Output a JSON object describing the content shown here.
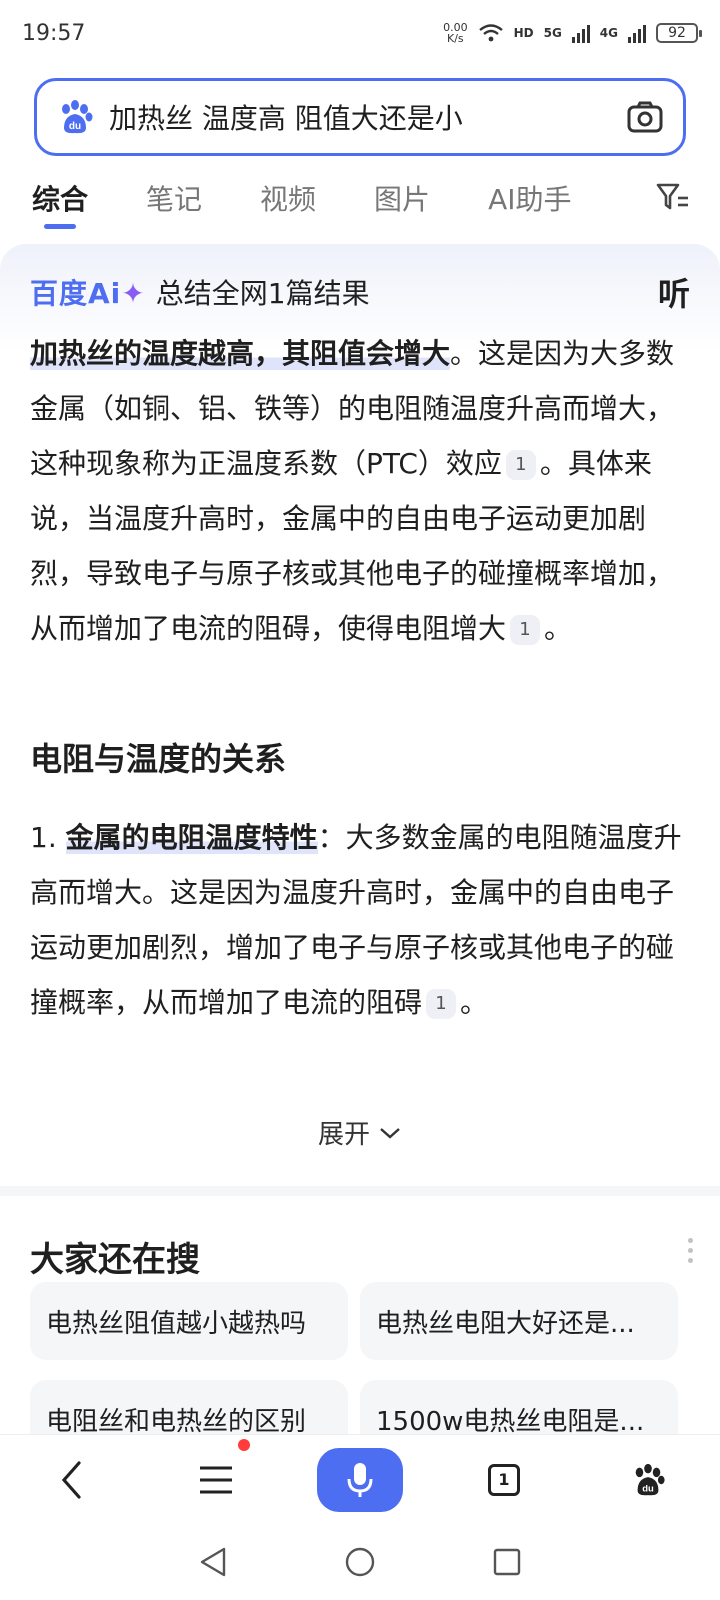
{
  "status_bar": {
    "time": "19:57",
    "net_speed_value": "0.00",
    "net_speed_unit": "K/s",
    "hd_label": "HD",
    "signal1_label": "5G",
    "signal2_label": "4G",
    "battery": "92"
  },
  "search": {
    "query": "加热丝 温度高 阻值大还是小"
  },
  "tabs": [
    {
      "label": "综合",
      "active": true
    },
    {
      "label": "笔记",
      "active": false
    },
    {
      "label": "视频",
      "active": false
    },
    {
      "label": "图片",
      "active": false
    },
    {
      "label": "AI助手",
      "active": false
    }
  ],
  "ai_card": {
    "logo_text": "百度Ai",
    "logo_sparkle": "✦",
    "summary": "总结全网1篇结果",
    "listen_label": "听",
    "para_bold": "加热丝的温度越高，其阻值会增大",
    "para_1": "。这是因为大多数金属（如铜、铝、铁等）的电阻随温度升高而增大，这种现象称为正温度系数（PTC）效应",
    "para_2": "。具体来说，当温度升高时，金属中的自由电子运动更加剧烈，导致电子与原子核或其他电子的碰撞概率增加，从而增加了电流的阻碍，使得电阻增大",
    "para_3": "。",
    "ref_1": "1",
    "section_title": "电阻与温度的关系",
    "list_num": "1.",
    "list_bold": "金属的电阻温度特性",
    "list_text": "：大多数金属的电阻随温度升高而增大。这是因为温度升高时，金属中的自由电子运动更加剧烈，增加了电子与原子核或其他电子的碰撞概率，从而增加了电流的阻碍",
    "list_end": "。",
    "expand_label": "展开"
  },
  "also_search": {
    "title": "大家还在搜",
    "chips": [
      "电热丝阻值越小越热吗",
      "电热丝电阻大好还是...",
      "电阻丝和电热丝的区别",
      "1500w电热丝电阻是..."
    ]
  },
  "bottom_nav": {
    "tab_count": "1"
  },
  "colors": {
    "accent": "#4e6ef2",
    "highlight": "#e0e4fb",
    "red_dot": "#ff3b3b"
  }
}
